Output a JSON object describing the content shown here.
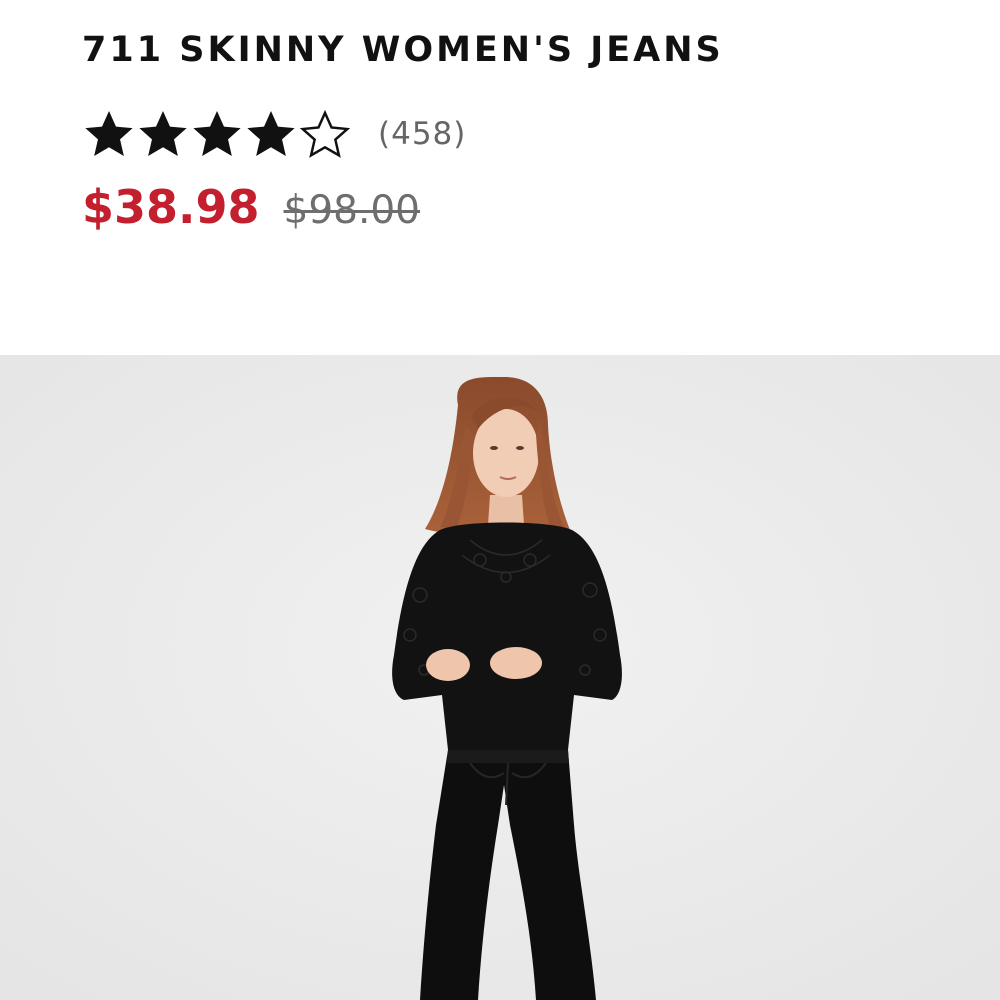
{
  "product": {
    "title": "711 SKINNY WOMEN'S JEANS",
    "rating": {
      "stars_filled": 4,
      "stars_total": 5,
      "review_count": "(458)"
    },
    "price": {
      "sale": "$38.98",
      "original": "$98.00"
    },
    "image": {
      "subject": "model-wearing-black-skinny-jeans-and-black-lace-top"
    }
  },
  "colors": {
    "sale_price": "#c41f2e",
    "original_price": "#6e6e6e",
    "star": "#111111",
    "image_background": "#ececec"
  }
}
